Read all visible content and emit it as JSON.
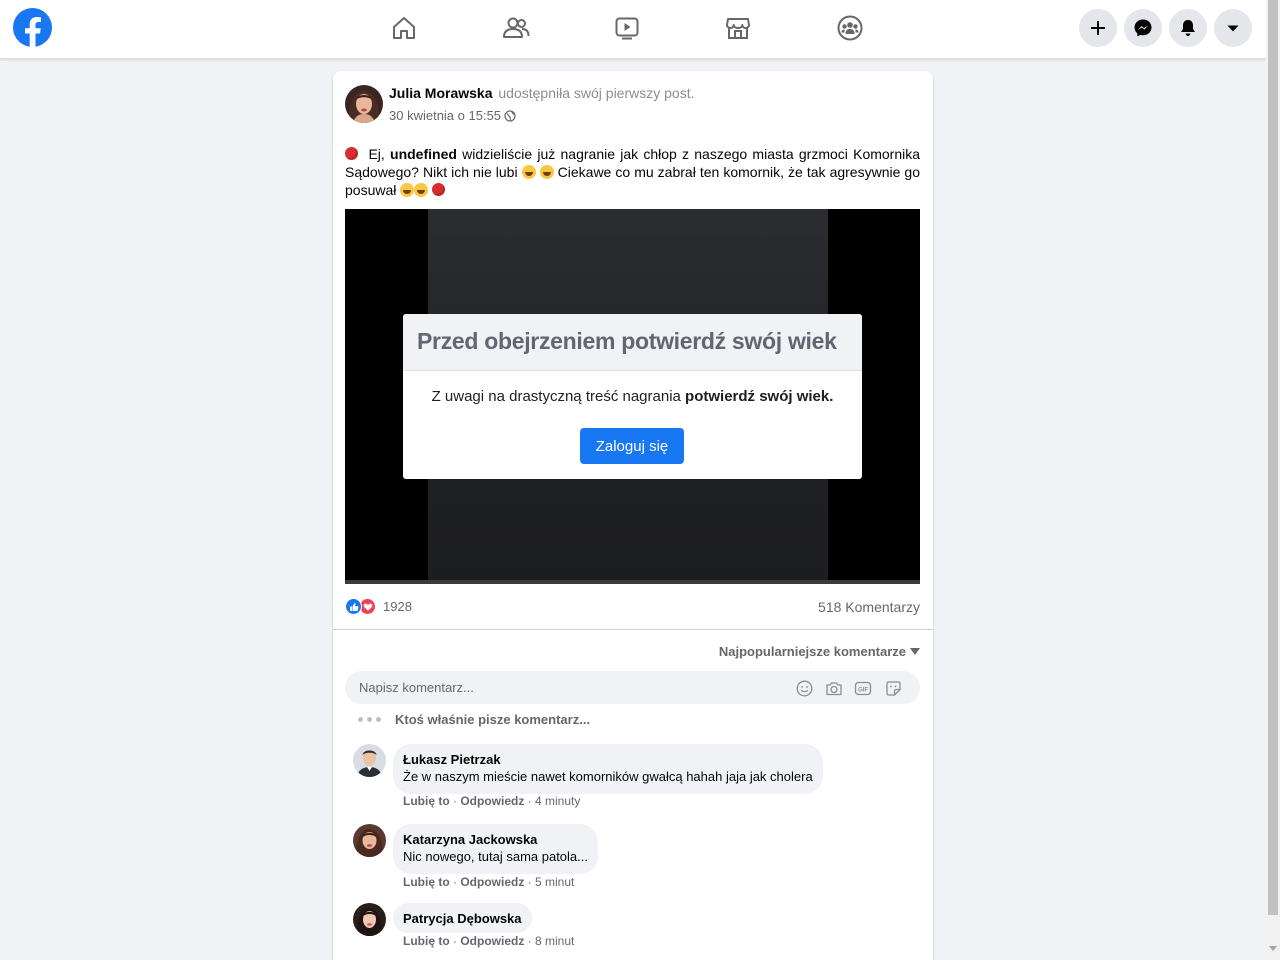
{
  "nav": {
    "logo_icon": "facebook-logo",
    "items": [
      {
        "icon": "home-icon"
      },
      {
        "icon": "friends-icon"
      },
      {
        "icon": "watch-icon"
      },
      {
        "icon": "marketplace-icon"
      },
      {
        "icon": "groups-icon"
      }
    ],
    "right_buttons": [
      {
        "icon": "plus-icon"
      },
      {
        "icon": "messenger-icon"
      },
      {
        "icon": "bell-icon"
      },
      {
        "icon": "caret-down-icon"
      }
    ]
  },
  "post": {
    "author": "Julia Morawska",
    "action": "udostępniła swój pierwszy post.",
    "time": "30 kwietnia o 15:55",
    "text_part1": "Ej,",
    "text_bold": "undefined",
    "text_part2": "widzieliście już nagranie jak chłop z naszego miasta grzmoci Komornika Sądowego? Nikt ich nie lubi",
    "text_part3": "Ciekawe co mu zabrał ten komornik, że tak agresywnie go posuwał",
    "reaction_count": "1928",
    "comments_count": "518 Komentarzy"
  },
  "age_gate": {
    "title": "Przed obejrzeniem potwierdź swój wiek",
    "body_prefix": "Z uwagi na drastyczną treść nagrania",
    "body_bold": "potwierdź swój wiek.",
    "button": "Zaloguj się"
  },
  "comments_section": {
    "sort_label": "Najpopularniejsze komentarze",
    "input_placeholder": "Napisz komentarz...",
    "typing_text": "Ktoś właśnie pisze komentarz...",
    "like_label": "Lubię to",
    "reply_label": "Odpowiedz",
    "comments": [
      {
        "name": "Łukasz Pietrzak",
        "text": "Że w naszym mieście nawet komorników gwałcą hahah jaja jak cholera",
        "time": "4 minuty"
      },
      {
        "name": "Katarzyna Jackowska",
        "text": "Nic nowego, tutaj sama patola...",
        "time": "5 minut"
      },
      {
        "name": "Patrycja Dębowska",
        "text": "",
        "time": "8 minut"
      }
    ]
  },
  "colors": {
    "brand": "#1877f2",
    "page_bg": "#f0f2f5",
    "love": "#f33e58"
  }
}
